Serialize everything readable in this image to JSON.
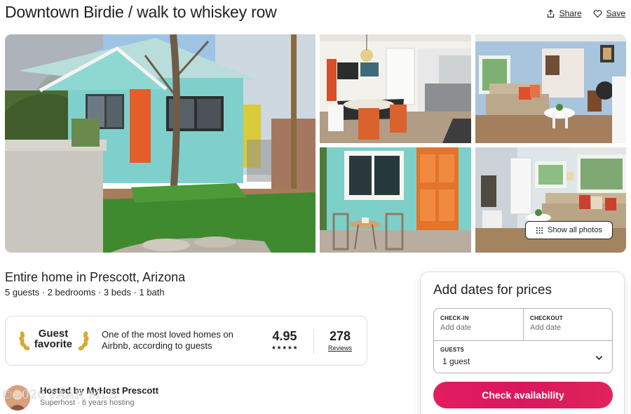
{
  "listing": {
    "title": "Downtown Birdie / walk to whiskey row",
    "type_location": "Entire home in Prescott, Arizona",
    "stats": "5 guests · 2 bedrooms · 3 beds · 1 bath"
  },
  "actions": {
    "share_label": "Share",
    "save_label": "Save"
  },
  "gallery": {
    "show_all_label": "Show all photos"
  },
  "favorite": {
    "label": "Guest favorite",
    "description": "One of the most loved homes on Airbnb, according to guests",
    "rating": "4.95",
    "stars": "★★★★★",
    "reviews_count": "278",
    "reviews_label": "Reviews"
  },
  "host": {
    "title": "Hosted by MyHost Prescott",
    "subtitle": "Superhost · 6 years hosting"
  },
  "watermark": "©2026 PAAR MLS",
  "booking": {
    "heading": "Add dates for prices",
    "checkin_label": "CHECK-IN",
    "checkin_value": "Add date",
    "checkout_label": "CHECKOUT",
    "checkout_value": "Add date",
    "guests_label": "GUESTS",
    "guests_value": "1 guest",
    "cta_label": "Check availability"
  },
  "colors": {
    "brand": "#e31c5f",
    "text": "#222222",
    "muted": "#717171",
    "border": "#dddddd"
  },
  "icons": {
    "share": "share-icon",
    "save": "heart-icon",
    "grid": "grid-icon",
    "laurel": "laurel-icon",
    "chevron": "chevron-down-icon"
  }
}
